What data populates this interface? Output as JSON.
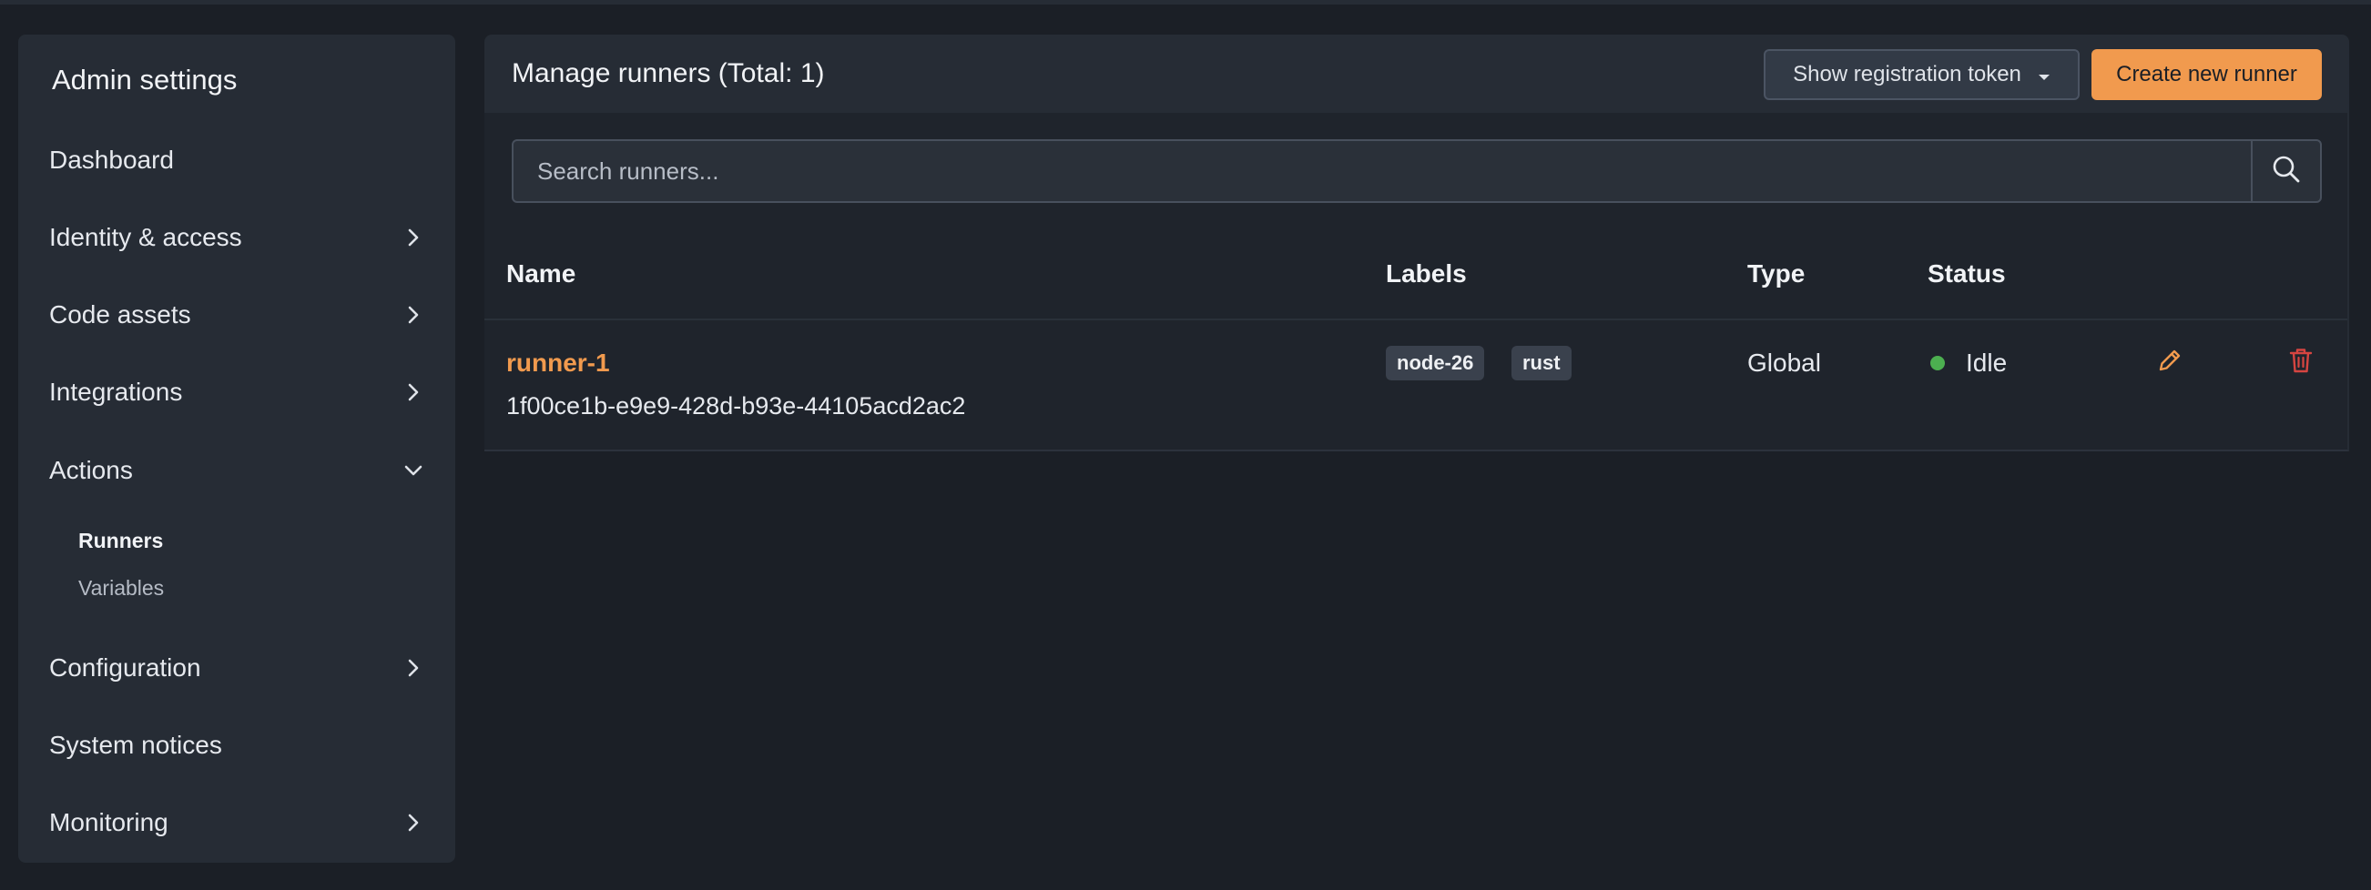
{
  "sidebar": {
    "title": "Admin settings",
    "items": [
      {
        "label": "Dashboard",
        "has_chevron": false
      },
      {
        "label": "Identity & access",
        "chevron": "chevron-right-icon"
      },
      {
        "label": "Code assets",
        "chevron": "chevron-right-icon"
      },
      {
        "label": "Integrations",
        "chevron": "chevron-right-icon"
      },
      {
        "label": "Actions",
        "chevron": "chevron-down-icon",
        "expanded": true,
        "children": [
          {
            "label": "Runners",
            "active": true
          },
          {
            "label": "Variables",
            "active": false
          }
        ]
      },
      {
        "label": "Configuration",
        "chevron": "chevron-right-icon"
      },
      {
        "label": "System notices",
        "has_chevron": false
      },
      {
        "label": "Monitoring",
        "chevron": "chevron-right-icon"
      }
    ]
  },
  "main": {
    "title": "Manage runners (Total: 1)",
    "token_button": {
      "label": "Show registration token",
      "icon": "caret-down-icon"
    },
    "create_button": {
      "label": "Create new runner"
    },
    "search": {
      "placeholder": "Search runners...",
      "value": "",
      "icon": "search-icon"
    },
    "table": {
      "columns": [
        "Name",
        "Labels",
        "Type",
        "Status"
      ],
      "rows": [
        {
          "name": "runner-1",
          "id": "1f00ce1b-e9e9-428d-b93e-44105acd2ac2",
          "labels": [
            "node-26",
            "rust"
          ],
          "type": "Global",
          "status": "Idle",
          "status_color": "#4caf50",
          "actions": [
            "edit-icon",
            "trash-icon"
          ]
        }
      ]
    }
  },
  "colors": {
    "accent": "#f19a4e",
    "danger": "#d64541",
    "background": "#1b1f26",
    "panel": "#262c35"
  }
}
